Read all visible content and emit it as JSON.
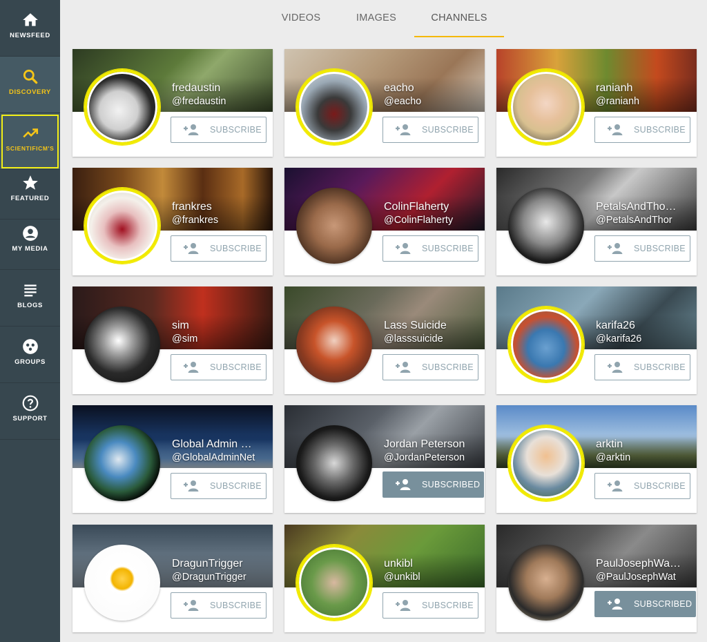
{
  "sidebar": {
    "items": [
      {
        "label": "NEWSFEED",
        "icon": "home-icon"
      },
      {
        "label": "DISCOVERY",
        "icon": "search-icon"
      },
      {
        "label": "SCIENTIFICM'S",
        "icon": "trending-icon"
      },
      {
        "label": "FEATURED",
        "icon": "star-icon"
      },
      {
        "label": "MY MEDIA",
        "icon": "account-icon"
      },
      {
        "label": "BLOGS",
        "icon": "lines-icon"
      },
      {
        "label": "GROUPS",
        "icon": "groups-icon"
      },
      {
        "label": "SUPPORT",
        "icon": "help-icon"
      }
    ]
  },
  "tabs": [
    {
      "label": "VIDEOS"
    },
    {
      "label": "IMAGES"
    },
    {
      "label": "CHANNELS"
    }
  ],
  "channels": [
    {
      "name": "fredaustin",
      "handle": "@fredaustin",
      "button": "SUBSCRIBE"
    },
    {
      "name": "eacho",
      "handle": "@eacho",
      "button": "SUBSCRIBE"
    },
    {
      "name": "ranianh",
      "handle": "@ranianh",
      "button": "SUBSCRIBE"
    },
    {
      "name": "frankres",
      "handle": "@frankres",
      "button": "SUBSCRIBE"
    },
    {
      "name": "ColinFlaherty",
      "handle": "@ColinFlaherty",
      "button": "SUBSCRIBE"
    },
    {
      "name": "PetalsAndTho…",
      "handle": "@PetalsAndThor",
      "button": "SUBSCRIBE"
    },
    {
      "name": "sim",
      "handle": "@sim",
      "button": "SUBSCRIBE"
    },
    {
      "name": "Lass Suicide",
      "handle": "@lasssuicide",
      "button": "SUBSCRIBE"
    },
    {
      "name": "karifa26",
      "handle": "@karifa26",
      "button": "SUBSCRIBE"
    },
    {
      "name": "Global Admin …",
      "handle": "@GlobalAdminNet",
      "button": "SUBSCRIBE"
    },
    {
      "name": "Jordan Peterson",
      "handle": "@JordanPeterson",
      "button": "SUBSCRIBED"
    },
    {
      "name": "arktin",
      "handle": "@arktin",
      "button": "SUBSCRIBE"
    },
    {
      "name": "DragunTrigger",
      "handle": "@DragunTrigger",
      "button": "SUBSCRIBE"
    },
    {
      "name": "unkibl",
      "handle": "@unkibl",
      "button": "SUBSCRIBE"
    },
    {
      "name": "PaulJosephWa…",
      "handle": "@PaulJosephWat",
      "button": "SUBSCRIBED"
    }
  ],
  "colors": {
    "sidebar": "#37474f",
    "accent": "#f5c518",
    "ring": "#f1ea00",
    "subscribed": "#78909c"
  }
}
